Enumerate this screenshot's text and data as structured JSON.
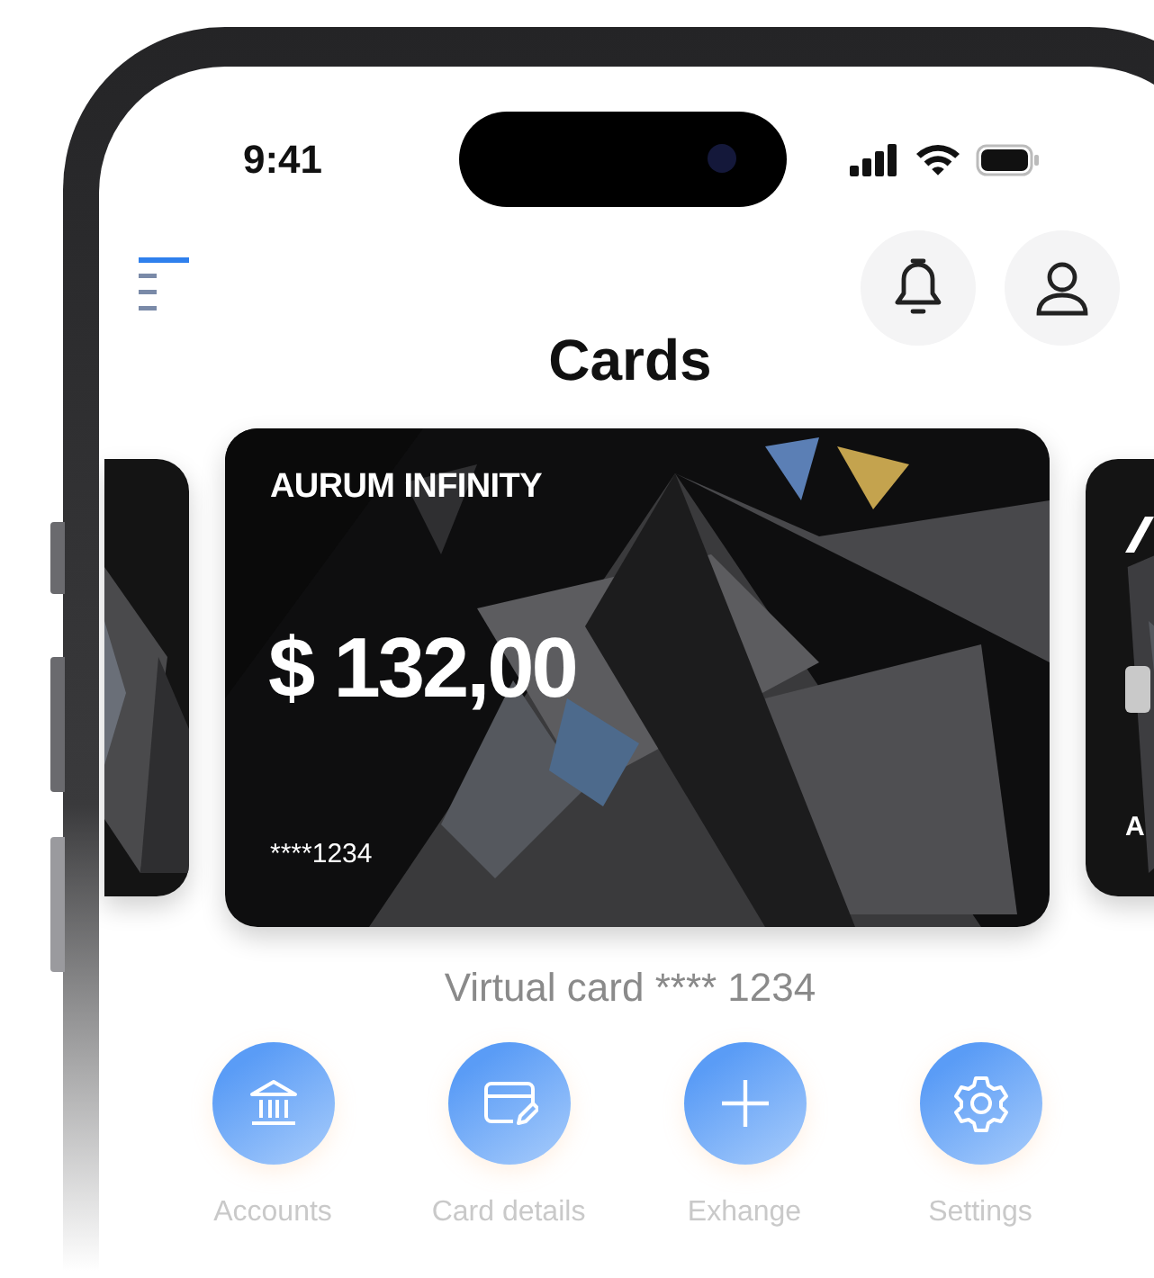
{
  "status_bar": {
    "time": "9:41"
  },
  "header": {
    "title": "Cards"
  },
  "main_card": {
    "name": "AURUM INFINITY",
    "balance": "$ 132,00",
    "number": "****1234"
  },
  "next_card": {
    "label": "A"
  },
  "card_caption": "Virtual card **** 1234",
  "actions": [
    {
      "label": "Accounts"
    },
    {
      "label": "Card details"
    },
    {
      "label": "Exhange"
    },
    {
      "label": "Settings"
    }
  ]
}
